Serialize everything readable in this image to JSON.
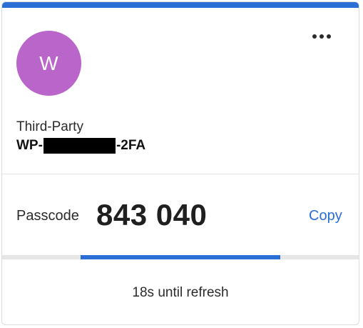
{
  "colors": {
    "accent": "#2a6ed6",
    "avatar": "#b965c9"
  },
  "account": {
    "avatar_letter": "W",
    "issuer": "Third-Party",
    "name_prefix": "WP-",
    "name_suffix": "-2FA"
  },
  "menu": {
    "icon": "more-horizontal-icon"
  },
  "code": {
    "label": "Passcode",
    "value": "843 040",
    "copy_label": "Copy"
  },
  "refresh": {
    "text": "18s until refresh",
    "progress_fraction": 0.56
  }
}
